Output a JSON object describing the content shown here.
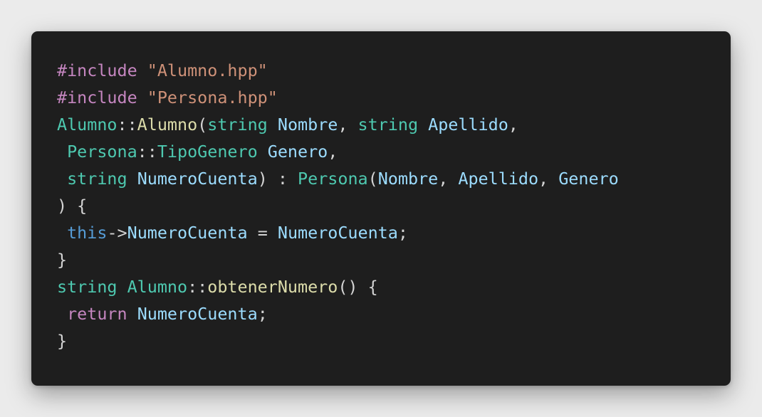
{
  "colors": {
    "background": "#ebebeb",
    "editor_background": "#1e1e1e",
    "default": "#d4d4d4",
    "keyword": "#569cd6",
    "control": "#c586c0",
    "string": "#ce9178",
    "type": "#4ec9b0",
    "function": "#dcdcaa",
    "variable": "#9cdcfe"
  },
  "code": {
    "lines": [
      [
        {
          "text": "#include",
          "kind": "control"
        },
        {
          "text": " ",
          "kind": "punct"
        },
        {
          "text": "\"Alumno.hpp\"",
          "kind": "string"
        }
      ],
      [
        {
          "text": "#include",
          "kind": "control"
        },
        {
          "text": " ",
          "kind": "punct"
        },
        {
          "text": "\"Persona.hpp\"",
          "kind": "string"
        }
      ],
      [
        {
          "text": "Alumno",
          "kind": "type"
        },
        {
          "text": "::",
          "kind": "punct"
        },
        {
          "text": "Alumno",
          "kind": "function"
        },
        {
          "text": "(",
          "kind": "punct"
        },
        {
          "text": "string",
          "kind": "type"
        },
        {
          "text": " ",
          "kind": "punct"
        },
        {
          "text": "Nombre",
          "kind": "variable"
        },
        {
          "text": ", ",
          "kind": "punct"
        },
        {
          "text": "string",
          "kind": "type"
        },
        {
          "text": " ",
          "kind": "punct"
        },
        {
          "text": "Apellido",
          "kind": "variable"
        },
        {
          "text": ",",
          "kind": "punct"
        }
      ],
      [
        {
          "text": " ",
          "kind": "punct"
        },
        {
          "text": "Persona",
          "kind": "type"
        },
        {
          "text": "::",
          "kind": "punct"
        },
        {
          "text": "TipoGenero",
          "kind": "type"
        },
        {
          "text": " ",
          "kind": "punct"
        },
        {
          "text": "Genero",
          "kind": "variable"
        },
        {
          "text": ",",
          "kind": "punct"
        }
      ],
      [
        {
          "text": " ",
          "kind": "punct"
        },
        {
          "text": "string",
          "kind": "type"
        },
        {
          "text": " ",
          "kind": "punct"
        },
        {
          "text": "NumeroCuenta",
          "kind": "variable"
        },
        {
          "text": ") : ",
          "kind": "punct"
        },
        {
          "text": "Persona",
          "kind": "type"
        },
        {
          "text": "(",
          "kind": "punct"
        },
        {
          "text": "Nombre",
          "kind": "variable"
        },
        {
          "text": ", ",
          "kind": "punct"
        },
        {
          "text": "Apellido",
          "kind": "variable"
        },
        {
          "text": ", ",
          "kind": "punct"
        },
        {
          "text": "Genero",
          "kind": "variable"
        }
      ],
      [
        {
          "text": ") {",
          "kind": "punct"
        }
      ],
      [
        {
          "text": " ",
          "kind": "punct"
        },
        {
          "text": "this",
          "kind": "keyword"
        },
        {
          "text": "->",
          "kind": "punct"
        },
        {
          "text": "NumeroCuenta",
          "kind": "variable"
        },
        {
          "text": " = ",
          "kind": "punct"
        },
        {
          "text": "NumeroCuenta",
          "kind": "variable"
        },
        {
          "text": ";",
          "kind": "punct"
        }
      ],
      [
        {
          "text": "}",
          "kind": "punct"
        }
      ],
      [
        {
          "text": "string",
          "kind": "type"
        },
        {
          "text": " ",
          "kind": "punct"
        },
        {
          "text": "Alumno",
          "kind": "type"
        },
        {
          "text": "::",
          "kind": "punct"
        },
        {
          "text": "obtenerNumero",
          "kind": "function"
        },
        {
          "text": "() {",
          "kind": "punct"
        }
      ],
      [
        {
          "text": " ",
          "kind": "punct"
        },
        {
          "text": "return",
          "kind": "control"
        },
        {
          "text": " ",
          "kind": "punct"
        },
        {
          "text": "NumeroCuenta",
          "kind": "variable"
        },
        {
          "text": ";",
          "kind": "punct"
        }
      ],
      [
        {
          "text": "}",
          "kind": "punct"
        }
      ]
    ]
  }
}
